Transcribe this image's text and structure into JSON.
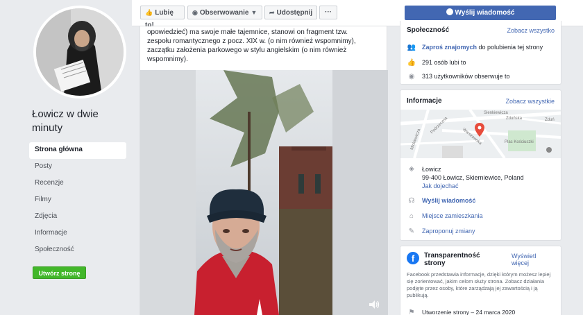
{
  "page": {
    "name": "Łowicz w dwie minuty"
  },
  "nav": {
    "items": [
      {
        "label": "Strona główna"
      },
      {
        "label": "Posty"
      },
      {
        "label": "Recenzje"
      },
      {
        "label": "Filmy"
      },
      {
        "label": "Zdjęcia"
      },
      {
        "label": "Informacje"
      },
      {
        "label": "Społeczność"
      }
    ],
    "create_label": "Utwórz stronę"
  },
  "actions": {
    "like_label": "Lubię to!",
    "follow_label": "Obserwowanie",
    "share_label": "Udostępnij",
    "more_label": "···",
    "message_label": "Wyślij wiadomość"
  },
  "post": {
    "lines": [
      "opowiedzieć) ma swoje małe tajemnice, stanowi on fragment tzw.",
      "zespołu romantycznego z pocz. XIX w. (o nim również wspomnimy),",
      "zaczątku założenia parkowego w stylu angielskim (o nim również",
      "wspomnimy)."
    ]
  },
  "community": {
    "title": "Społeczność",
    "see_all": "Zobacz wszystko",
    "invite_link": "Zaproś znajomych",
    "invite_rest": "do polubienia tej strony",
    "likes": "291 osób lubi to",
    "followers": "313 użytkowników obserwuje to"
  },
  "info": {
    "title": "Informacje",
    "see_all": "Zobacz wszystkie",
    "map_streets": [
      "Sienkiewicza",
      "Zduńska",
      "Zduń",
      "Podrzeczna",
      "Warszawska",
      "Mickiewicza",
      "Plac Kościuszki"
    ],
    "city": "Łowicz",
    "address": "99-400 Łowicz, Skierniewice, Poland",
    "directions": "Jak dojechać",
    "send_message": "Wyślij wiadomość",
    "residence": "Miejsce zamieszkania",
    "suggest_edits": "Zaproponuj zmiany"
  },
  "transparency": {
    "title": "Transparentność strony",
    "show_more": "Wyświetl więcej",
    "description": "Facebook przedstawia informacje, dzięki którym możesz lepiej się zorientować, jakim celom służy strona. Zobacz działania podjęte przez osoby, które zarządzają jej zawartością i ją publikują.",
    "created": "Utworzenie strony – 24 marca 2020"
  },
  "colors": {
    "facebook_blue": "#4267b2",
    "create_green": "#42b72a",
    "map_pin": "#e74c3c"
  }
}
